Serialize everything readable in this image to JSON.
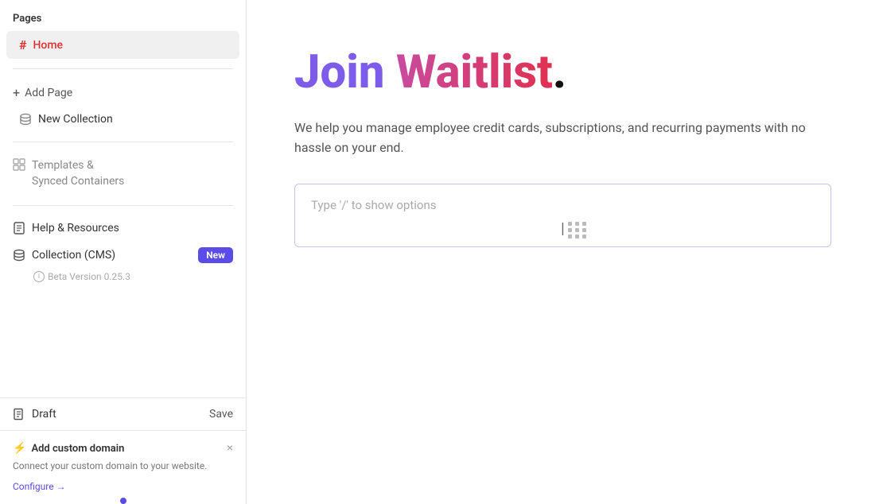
{
  "sidebar": {
    "pages_label": "Pages",
    "home_item": "Home",
    "add_page": "Add Page",
    "new_collection": "New Collection",
    "templates_label": "Templates &\nSynced Containers",
    "help_resources": "Help & Resources",
    "collection_cms": "Collection (CMS)",
    "new_badge": "New",
    "beta_version": "Beta Version 0.25.3",
    "draft_label": "Draft",
    "save_label": "Save",
    "custom_domain_title": "Add custom domain",
    "custom_domain_desc": "Connect your custom domain to your website.",
    "configure_link": "Configure →"
  },
  "main": {
    "hero_join": "Join ",
    "hero_waitlist": "Waitlist",
    "hero_dot": ".",
    "subtitle": "We help you manage employee credit cards, subscriptions, and recurring payments with no hassle on your end.",
    "input_placeholder": "Type '/' to show options"
  },
  "icons": {
    "hash": "#",
    "cylinder": "⊟",
    "plus": "+",
    "book": "📖",
    "grid_small": "⊞",
    "document": "🗋",
    "lightning": "⚡",
    "close": "×",
    "info": "ℹ"
  }
}
